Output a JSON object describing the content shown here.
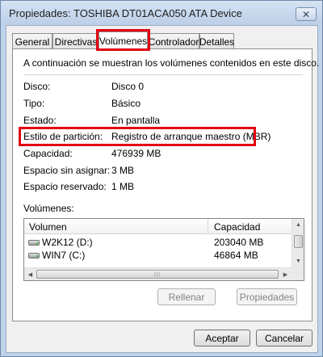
{
  "window": {
    "title": "Propiedades: TOSHIBA DT01ACA050 ATA Device",
    "close_symbol": "✕"
  },
  "tabs": [
    {
      "label": "General"
    },
    {
      "label": "Directivas"
    },
    {
      "label": "Volúmenes"
    },
    {
      "label": "Controlador"
    },
    {
      "label": "Detalles"
    }
  ],
  "active_tab": "Volúmenes",
  "intro_text": "A continuación se muestran los volúmenes contenidos en este disco.",
  "properties": [
    {
      "label": "Disco:",
      "value": "Disco 0"
    },
    {
      "label": "Tipo:",
      "value": "Básico"
    },
    {
      "label": "Estado:",
      "value": "En pantalla"
    },
    {
      "label": "Estilo de partición:",
      "value": "Registro de arranque maestro (MBR)"
    },
    {
      "label": "Capacidad:",
      "value": "476939 MB"
    },
    {
      "label": "Espacio sin asignar:",
      "value": "3 MB"
    },
    {
      "label": "Espacio reservado:",
      "value": "1 MB"
    }
  ],
  "volumes": {
    "label": "Volúmenes:",
    "columns": [
      "Volumen",
      "Capacidad"
    ],
    "rows": [
      {
        "name": "W2K12 (D:)",
        "capacity": "203040 MB",
        "icon": "drive-icon"
      },
      {
        "name": "WIN7 (C:)",
        "capacity": "46864 MB",
        "icon": "drive-icon"
      }
    ]
  },
  "buttons": {
    "rellenar": "Rellenar",
    "propiedades": "Propiedades",
    "aceptar": "Aceptar",
    "cancelar": "Cancelar"
  },
  "highlight_color": "#e2000f"
}
